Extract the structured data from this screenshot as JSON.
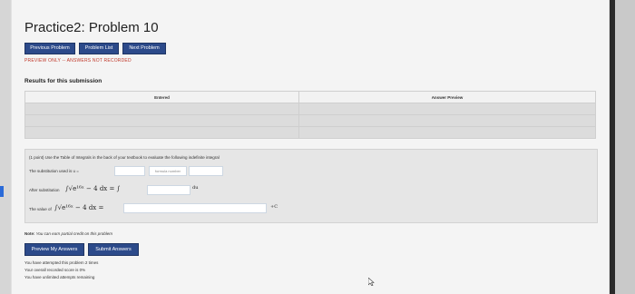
{
  "page": {
    "title": "Practice2: Problem 10"
  },
  "nav": {
    "previous_label": "Previous Problem",
    "list_label": "Problem List",
    "next_label": "Next Problem"
  },
  "preview_notice": "PREVIEW ONLY -- ANSWERS NOT RECORDED",
  "results": {
    "heading": "Results for this submission",
    "columns": [
      "Entered",
      "Answer Preview"
    ],
    "rows": [
      [
        "",
        ""
      ],
      [
        "",
        ""
      ],
      [
        "",
        ""
      ]
    ]
  },
  "problem": {
    "statement": "(1 point) Use the Table of Integrals in the back of your textbook to evaluate the following indefinite integral",
    "substitution_label": "The substitution used is u =",
    "formula_placeholder": "formula number",
    "after_sub_label": "After substitution",
    "after_sub_math": "∫√e¹⁶ˣ − 4 dx = ∫",
    "du_label": "du",
    "value_label": "The value of",
    "value_math": "∫√e¹⁶ˣ − 4 dx =",
    "constant": "+C"
  },
  "note": {
    "label": "Note:",
    "text": " You can earn partial credit on this problem"
  },
  "buttons": {
    "preview_label": "Preview My Answers",
    "submit_label": "Submit Answers"
  },
  "status": {
    "attempted": "You have attempted this problem 2 times",
    "score": "Your overall recorded score is 0%",
    "remaining": "You have unlimited attempts remaining"
  },
  "colors": {
    "button": "#2c4a8a",
    "preview_notice": "#c0392b"
  }
}
